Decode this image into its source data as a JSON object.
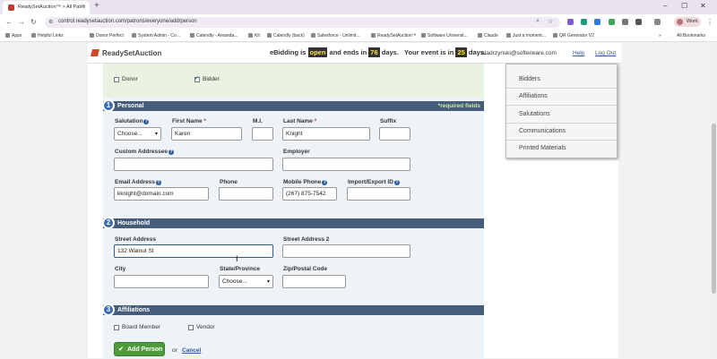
{
  "browser": {
    "tab_title": "ReadySetAuction™ > All Patro",
    "url": "control.readysetauction.com/patrons/everyone/add/person",
    "profile_label": "Work",
    "bookmarks": [
      "Apps",
      "Helpful Links",
      "Donor Perfect",
      "System Admin - Co...",
      "Calendly - Amanda...",
      "Kit",
      "Calendly (back)",
      "Salesforce - Unlimit...",
      "ReadySetAuction™",
      "Software Universit...",
      "Claude",
      "Just a moment...",
      "QR Generator V2"
    ],
    "all_bookmarks": "All Bookmarks"
  },
  "header": {
    "logo": "ReadySetAuction",
    "ebidding_prefix": "eBidding is",
    "ebidding_status": "open",
    "ends_in_text": "and ends in",
    "ebidding_days": "76",
    "days_label": "days.",
    "event_text": "Your event is in",
    "event_days": "25",
    "days_label2": "days.",
    "user_email": "atadrzynski@softerware.com",
    "help": "Help",
    "logout": "Log Out"
  },
  "donor_bidder": {
    "donor": "Donor",
    "bidder": "Bidder"
  },
  "personal": {
    "num": "1",
    "title": "Personal",
    "required_note": "*required fields",
    "salutation_label": "Salutation",
    "salutation_value": "Choose...",
    "first_name_label": "First Name",
    "first_name_value": "Karen",
    "mi_label": "M.I.",
    "last_name_label": "Last Name",
    "last_name_value": "Knight",
    "suffix_label": "Suffix",
    "custom_addressee_label": "Custom Addressee",
    "employer_label": "Employer",
    "email_label": "Email Address",
    "email_value": "kknight@domain.com",
    "phone_label": "Phone",
    "mobile_label": "Mobile Phone",
    "mobile_value": "(267) 875-7542",
    "import_export_label": "Import/Export ID"
  },
  "household": {
    "num": "2",
    "title": "Household",
    "street_label": "Street Address",
    "street_value": "132 Walnut St",
    "street2_label": "Street Address 2",
    "city_label": "City",
    "state_label": "State/Province",
    "state_value": "Choose...",
    "zip_label": "Zip/Postal Code"
  },
  "affiliations": {
    "num": "3",
    "title": "Affiliations",
    "board_member": "Board Member",
    "vendor": "Vendor"
  },
  "actions": {
    "add_person": "Add Person",
    "or": "or",
    "cancel": "Cancel"
  },
  "side_menu": {
    "items": [
      "Bidders",
      "Affiliations",
      "Salutations",
      "Communications",
      "Printed Materials"
    ]
  },
  "colors": {
    "section_header": "#455c7b",
    "accent_green": "#4f9a3a",
    "link_blue": "#2b5a9e"
  }
}
